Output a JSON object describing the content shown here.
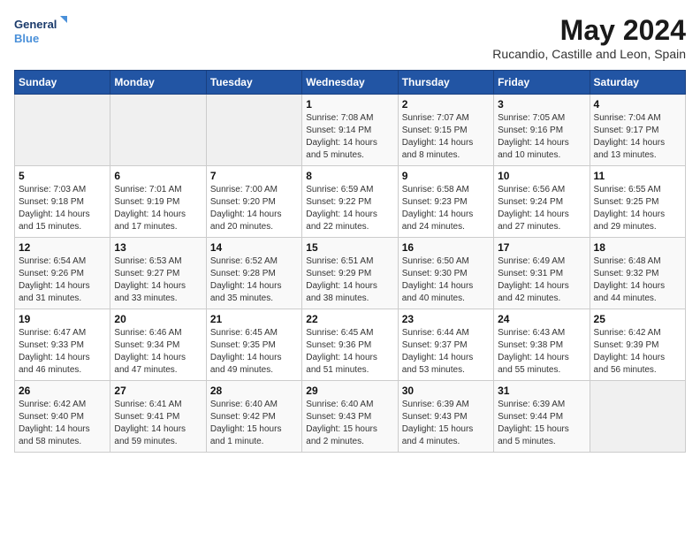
{
  "logo": {
    "line1": "General",
    "line2": "Blue"
  },
  "title": "May 2024",
  "subtitle": "Rucandio, Castille and Leon, Spain",
  "days_header": [
    "Sunday",
    "Monday",
    "Tuesday",
    "Wednesday",
    "Thursday",
    "Friday",
    "Saturday"
  ],
  "weeks": [
    [
      {
        "num": "",
        "info": ""
      },
      {
        "num": "",
        "info": ""
      },
      {
        "num": "",
        "info": ""
      },
      {
        "num": "1",
        "info": "Sunrise: 7:08 AM\nSunset: 9:14 PM\nDaylight: 14 hours\nand 5 minutes."
      },
      {
        "num": "2",
        "info": "Sunrise: 7:07 AM\nSunset: 9:15 PM\nDaylight: 14 hours\nand 8 minutes."
      },
      {
        "num": "3",
        "info": "Sunrise: 7:05 AM\nSunset: 9:16 PM\nDaylight: 14 hours\nand 10 minutes."
      },
      {
        "num": "4",
        "info": "Sunrise: 7:04 AM\nSunset: 9:17 PM\nDaylight: 14 hours\nand 13 minutes."
      }
    ],
    [
      {
        "num": "5",
        "info": "Sunrise: 7:03 AM\nSunset: 9:18 PM\nDaylight: 14 hours\nand 15 minutes."
      },
      {
        "num": "6",
        "info": "Sunrise: 7:01 AM\nSunset: 9:19 PM\nDaylight: 14 hours\nand 17 minutes."
      },
      {
        "num": "7",
        "info": "Sunrise: 7:00 AM\nSunset: 9:20 PM\nDaylight: 14 hours\nand 20 minutes."
      },
      {
        "num": "8",
        "info": "Sunrise: 6:59 AM\nSunset: 9:22 PM\nDaylight: 14 hours\nand 22 minutes."
      },
      {
        "num": "9",
        "info": "Sunrise: 6:58 AM\nSunset: 9:23 PM\nDaylight: 14 hours\nand 24 minutes."
      },
      {
        "num": "10",
        "info": "Sunrise: 6:56 AM\nSunset: 9:24 PM\nDaylight: 14 hours\nand 27 minutes."
      },
      {
        "num": "11",
        "info": "Sunrise: 6:55 AM\nSunset: 9:25 PM\nDaylight: 14 hours\nand 29 minutes."
      }
    ],
    [
      {
        "num": "12",
        "info": "Sunrise: 6:54 AM\nSunset: 9:26 PM\nDaylight: 14 hours\nand 31 minutes."
      },
      {
        "num": "13",
        "info": "Sunrise: 6:53 AM\nSunset: 9:27 PM\nDaylight: 14 hours\nand 33 minutes."
      },
      {
        "num": "14",
        "info": "Sunrise: 6:52 AM\nSunset: 9:28 PM\nDaylight: 14 hours\nand 35 minutes."
      },
      {
        "num": "15",
        "info": "Sunrise: 6:51 AM\nSunset: 9:29 PM\nDaylight: 14 hours\nand 38 minutes."
      },
      {
        "num": "16",
        "info": "Sunrise: 6:50 AM\nSunset: 9:30 PM\nDaylight: 14 hours\nand 40 minutes."
      },
      {
        "num": "17",
        "info": "Sunrise: 6:49 AM\nSunset: 9:31 PM\nDaylight: 14 hours\nand 42 minutes."
      },
      {
        "num": "18",
        "info": "Sunrise: 6:48 AM\nSunset: 9:32 PM\nDaylight: 14 hours\nand 44 minutes."
      }
    ],
    [
      {
        "num": "19",
        "info": "Sunrise: 6:47 AM\nSunset: 9:33 PM\nDaylight: 14 hours\nand 46 minutes."
      },
      {
        "num": "20",
        "info": "Sunrise: 6:46 AM\nSunset: 9:34 PM\nDaylight: 14 hours\nand 47 minutes."
      },
      {
        "num": "21",
        "info": "Sunrise: 6:45 AM\nSunset: 9:35 PM\nDaylight: 14 hours\nand 49 minutes."
      },
      {
        "num": "22",
        "info": "Sunrise: 6:45 AM\nSunset: 9:36 PM\nDaylight: 14 hours\nand 51 minutes."
      },
      {
        "num": "23",
        "info": "Sunrise: 6:44 AM\nSunset: 9:37 PM\nDaylight: 14 hours\nand 53 minutes."
      },
      {
        "num": "24",
        "info": "Sunrise: 6:43 AM\nSunset: 9:38 PM\nDaylight: 14 hours\nand 55 minutes."
      },
      {
        "num": "25",
        "info": "Sunrise: 6:42 AM\nSunset: 9:39 PM\nDaylight: 14 hours\nand 56 minutes."
      }
    ],
    [
      {
        "num": "26",
        "info": "Sunrise: 6:42 AM\nSunset: 9:40 PM\nDaylight: 14 hours\nand 58 minutes."
      },
      {
        "num": "27",
        "info": "Sunrise: 6:41 AM\nSunset: 9:41 PM\nDaylight: 14 hours\nand 59 minutes."
      },
      {
        "num": "28",
        "info": "Sunrise: 6:40 AM\nSunset: 9:42 PM\nDaylight: 15 hours\nand 1 minute."
      },
      {
        "num": "29",
        "info": "Sunrise: 6:40 AM\nSunset: 9:43 PM\nDaylight: 15 hours\nand 2 minutes."
      },
      {
        "num": "30",
        "info": "Sunrise: 6:39 AM\nSunset: 9:43 PM\nDaylight: 15 hours\nand 4 minutes."
      },
      {
        "num": "31",
        "info": "Sunrise: 6:39 AM\nSunset: 9:44 PM\nDaylight: 15 hours\nand 5 minutes."
      },
      {
        "num": "",
        "info": ""
      }
    ]
  ]
}
